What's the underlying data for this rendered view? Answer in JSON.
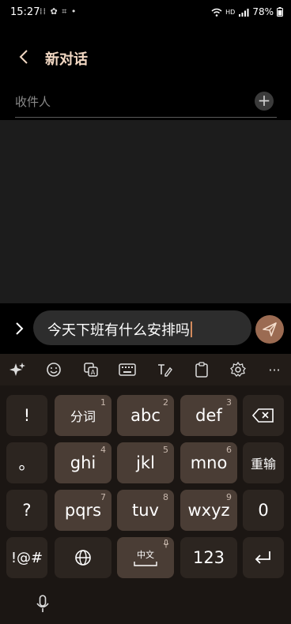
{
  "status_bar": {
    "time": "15:27",
    "left_icons": "⁞⁞ ✿ ⌗ •",
    "net": "HD",
    "battery": "78%"
  },
  "header": {
    "title": "新对话"
  },
  "recipient": {
    "placeholder": "收件人",
    "add_symbol": "+"
  },
  "composer": {
    "text": "今天下班有什么安排吗"
  },
  "keyboard": {
    "toolbar_icons": [
      "sparkle-icon",
      "emoji-icon",
      "translate-icon",
      "keyboard-icon",
      "handwriting-icon",
      "clipboard-icon",
      "settings-icon",
      "more-icon"
    ],
    "more": "···",
    "row1": {
      "k1": "!",
      "k2": "分词",
      "k2n": "1",
      "k3": "abc",
      "k3n": "2",
      "k4": "def",
      "k4n": "3"
    },
    "row2": {
      "k1": "。",
      "k2": "ghi",
      "k2n": "4",
      "k3": "jkl",
      "k3n": "5",
      "k4": "mno",
      "k4n": "6",
      "k5": "重输"
    },
    "row3": {
      "k1": "?",
      "k2": "pqrs",
      "k2n": "7",
      "k3": "tuv",
      "k3n": "8",
      "k4": "wxyz",
      "k4n": "9",
      "k5": "0"
    },
    "row4": {
      "k1": "!@#",
      "k3": "中文",
      "k4": "123"
    }
  },
  "colors": {
    "accent": "#f1d7c2",
    "send": "#9b6b52",
    "key": "#4a3d35",
    "key_dark": "#2c2520"
  }
}
